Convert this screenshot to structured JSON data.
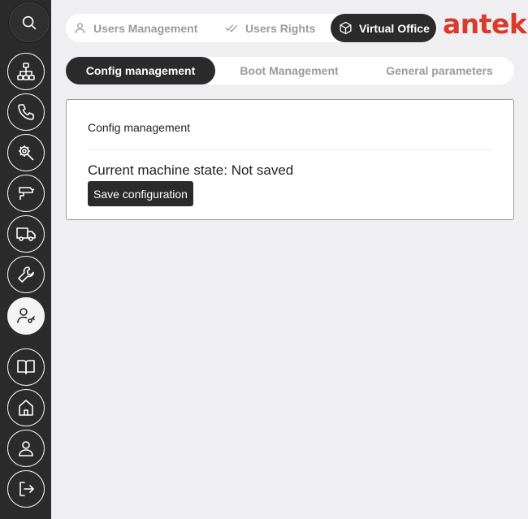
{
  "header": {
    "tabs": [
      {
        "label": "Users Management",
        "icon": "user-icon"
      },
      {
        "label": "Users Rights",
        "icon": "double-check-icon"
      },
      {
        "label": "Virtual Office",
        "icon": "cube-icon",
        "active": true
      }
    ],
    "logo": "antek"
  },
  "subtabs": [
    {
      "label": "Config management",
      "active": true
    },
    {
      "label": "Boot Management"
    },
    {
      "label": "General parameters"
    }
  ],
  "sidebar": {
    "items": [
      {
        "icon": "search-icon"
      },
      {
        "icon": "network-icon"
      },
      {
        "icon": "phone-icon"
      },
      {
        "icon": "tool-gear-icon"
      },
      {
        "icon": "camera-icon"
      },
      {
        "icon": "truck-icon"
      },
      {
        "icon": "wrench-icon"
      },
      {
        "icon": "user-key-icon",
        "active": true
      },
      {
        "icon": "book-icon"
      },
      {
        "icon": "home-icon"
      },
      {
        "icon": "profile-icon"
      },
      {
        "icon": "logout-icon"
      }
    ]
  },
  "panel": {
    "title": "Config management",
    "state_text": "Current machine state: Not saved",
    "save_button": "Save configuration"
  },
  "colors": {
    "sidebar": "#2b2b2b",
    "brand": "#d93a2a",
    "background": "#efeff1"
  }
}
